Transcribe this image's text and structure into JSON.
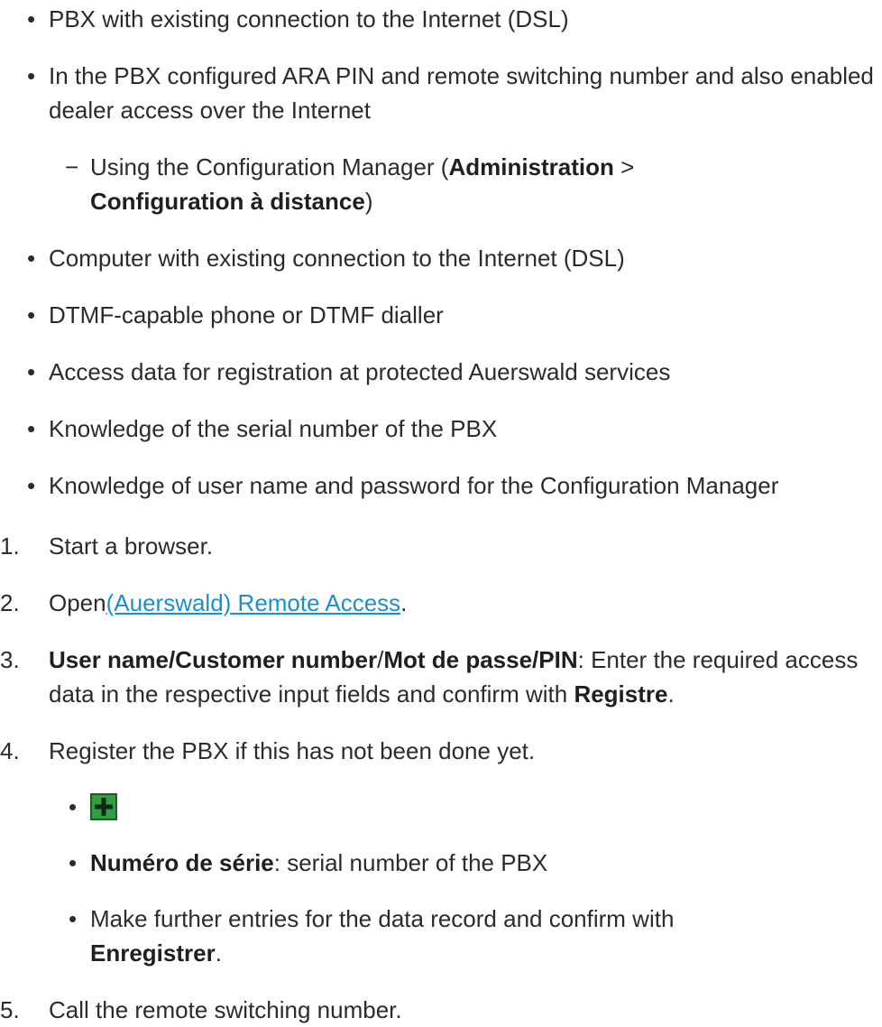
{
  "requirements": [
    {
      "text": "PBX with existing connection to the Internet (DSL)"
    },
    {
      "text": "In the PBX configured ARA PIN and remote switching number and also enabled dealer access over the Internet",
      "sub": {
        "prefix": "Using the Configuration Manager (",
        "bold1": "Administration",
        "sep": " > ",
        "bold2": "Configuration à distance",
        "suffix": ")"
      }
    },
    {
      "text": "Computer with existing connection to the Internet (DSL)"
    },
    {
      "text": "DTMF-capable phone or DTMF dialler"
    },
    {
      "text": "Access data for registration at protected Auerswald services"
    },
    {
      "text": "Knowledge of the serial number of the PBX"
    },
    {
      "text": "Knowledge of user name and password for the Configuration Manager"
    }
  ],
  "bullet_char": "•",
  "dash_char": "−",
  "steps": {
    "s1": {
      "num": "1.",
      "text": "Start a browser."
    },
    "s2": {
      "num": "2.",
      "prefix": "Open",
      "link": "(Auerswald) Remote Access",
      "suffix": "."
    },
    "s3": {
      "num": "3.",
      "bold1": "User name/Customer number",
      "slash": "/",
      "bold2": "Mot de passe/PIN",
      "mid": ": Enter the required access data in the respective input fields and confirm with ",
      "bold3": "Registre",
      "end": "."
    },
    "s4": {
      "num": "4.",
      "text": "Register the PBX if this has not been done yet.",
      "sub1_icon": "add-icon",
      "sub2_bold": "Numéro de série",
      "sub2_rest": ": serial number of the PBX",
      "sub3_text": "Make further entries for the data record and confirm with ",
      "sub3_bold": "Enregistrer",
      "sub3_end": "."
    },
    "s5": {
      "num": "5.",
      "text": "Call the remote switching number."
    }
  },
  "colors": {
    "text": "#2b2b2b",
    "link": "#1a8fd0",
    "icon_fill": "#2f9e44",
    "icon_border": "#1b5e20"
  }
}
